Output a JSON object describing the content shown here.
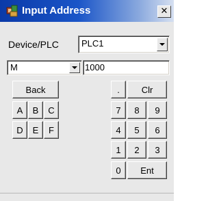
{
  "window": {
    "title": "Input Address",
    "close_glyph": "✕"
  },
  "device": {
    "label": "Device/PLC",
    "value": "PLC1"
  },
  "address": {
    "prefix": "M",
    "value": "1000"
  },
  "keys": {
    "back": "Back",
    "dot": ".",
    "clr": "Clr",
    "a": "A",
    "b": "B",
    "c": "C",
    "d": "D",
    "e": "E",
    "f": "F",
    "n7": "7",
    "n8": "8",
    "n9": "9",
    "n4": "4",
    "n5": "5",
    "n6": "6",
    "n1": "1",
    "n2": "2",
    "n3": "3",
    "n0": "0",
    "ent": "Ent"
  },
  "icons": {
    "title": "app-icon",
    "dropdown": "chevron-down-icon"
  }
}
